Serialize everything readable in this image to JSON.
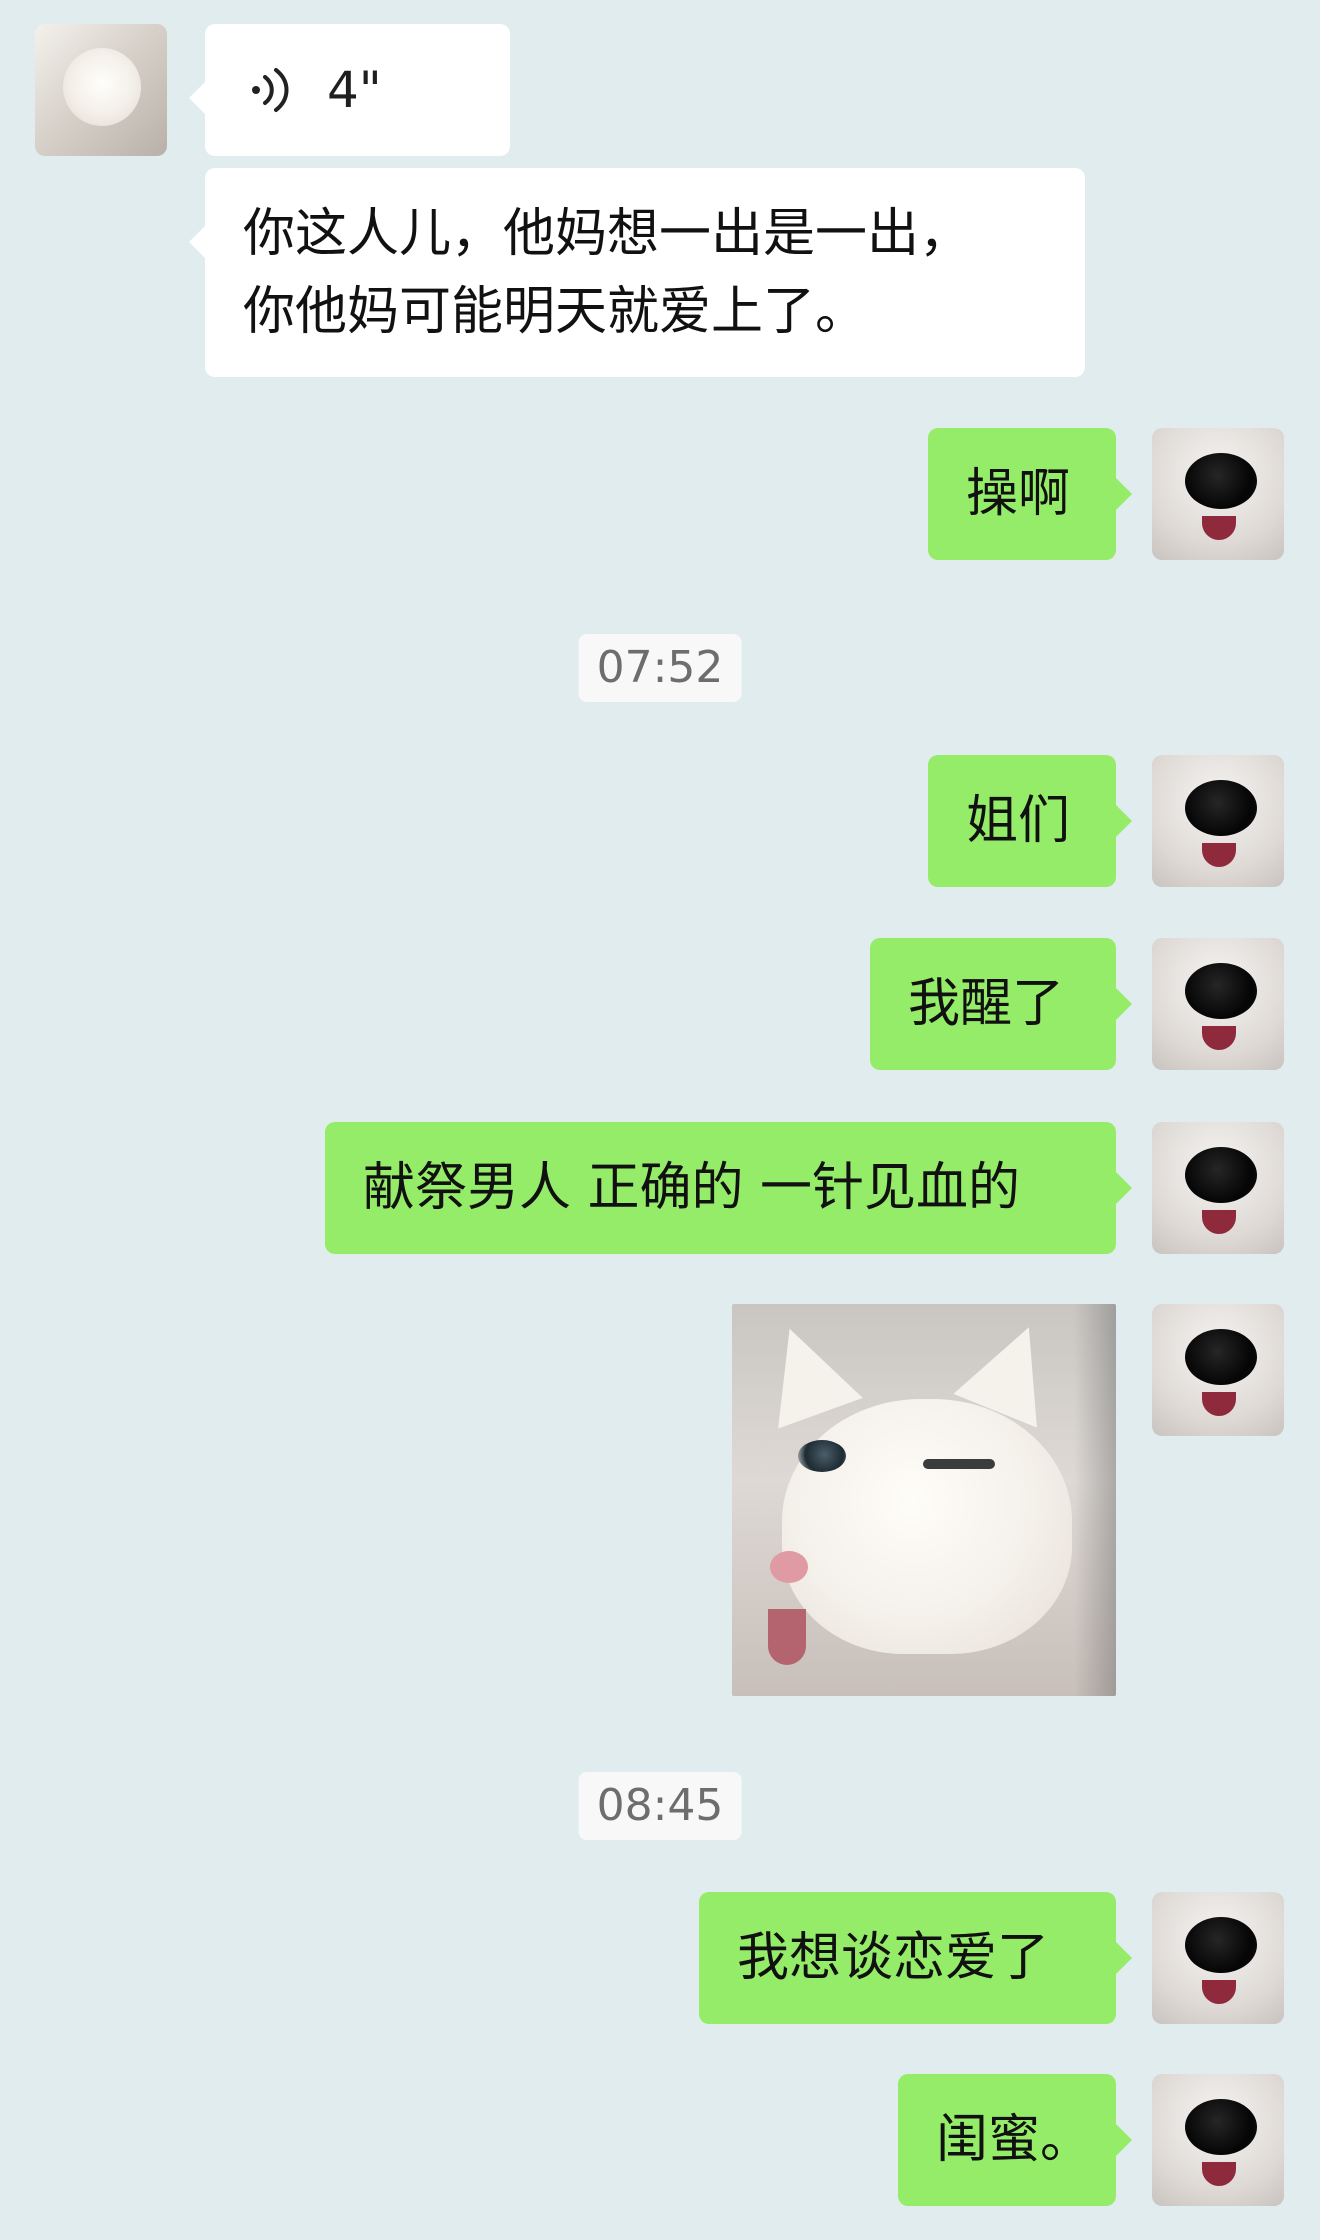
{
  "chat": {
    "messages": [
      {
        "sender": "other",
        "type": "voice",
        "duration": "4\""
      },
      {
        "sender": "other",
        "type": "text",
        "lines": [
          "你这人儿，他妈想一出是一出，",
          "你他妈可能明天就爱上了。"
        ]
      },
      {
        "sender": "me",
        "type": "text",
        "text": "操啊"
      },
      {
        "type": "timestamp",
        "text": "07:52"
      },
      {
        "sender": "me",
        "type": "text",
        "text": "姐们"
      },
      {
        "sender": "me",
        "type": "text",
        "text": "我醒了"
      },
      {
        "sender": "me",
        "type": "text",
        "text": "献祭男人 正确的 一针见血的"
      },
      {
        "sender": "me",
        "type": "image",
        "image_name": "white-cat-sticker"
      },
      {
        "type": "timestamp",
        "text": "08:45"
      },
      {
        "sender": "me",
        "type": "text",
        "text": "我想谈恋爱了"
      },
      {
        "sender": "me",
        "type": "text",
        "text": "闺蜜。"
      }
    ]
  },
  "colors": {
    "background": "#e1ecef",
    "incoming_bubble": "#ffffff",
    "outgoing_bubble": "#95ec69"
  },
  "icons": {
    "voice": "voice-message-icon"
  }
}
